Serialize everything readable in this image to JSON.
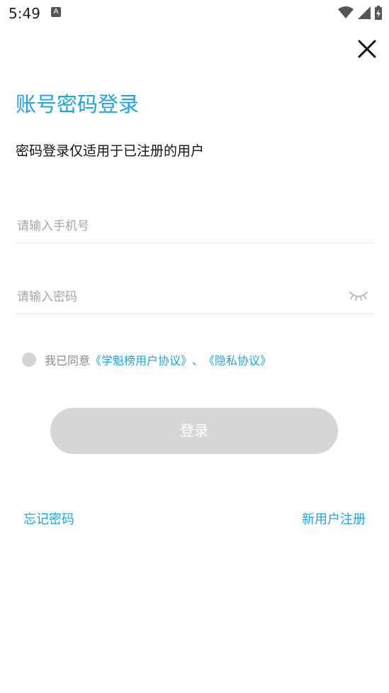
{
  "status_bar": {
    "time": "5:49",
    "notification_icon": "A",
    "icons": [
      "wifi-icon",
      "signal-icon",
      "battery-charging-icon"
    ]
  },
  "header": {
    "close_icon": "close-icon",
    "title": "账号密码登录",
    "subtitle": "密码登录仅适用于已注册的用户"
  },
  "form": {
    "phone_placeholder": "请输入手机号",
    "password_placeholder": "请输入密码",
    "password_toggle_icon": "eye-closed-icon"
  },
  "agreement": {
    "prefix": "我已同意",
    "user_agreement": "《学魁榜用户协议》",
    "separator": "、",
    "privacy_agreement": "《隐私协议》",
    "checked": false
  },
  "login_button": "登录",
  "links": {
    "forgot_password": "忘记密码",
    "register": "新用户注册"
  },
  "colors": {
    "accent": "#1fa3e8",
    "button_disabled": "#d6d6d6",
    "placeholder": "#a6a6a6"
  }
}
